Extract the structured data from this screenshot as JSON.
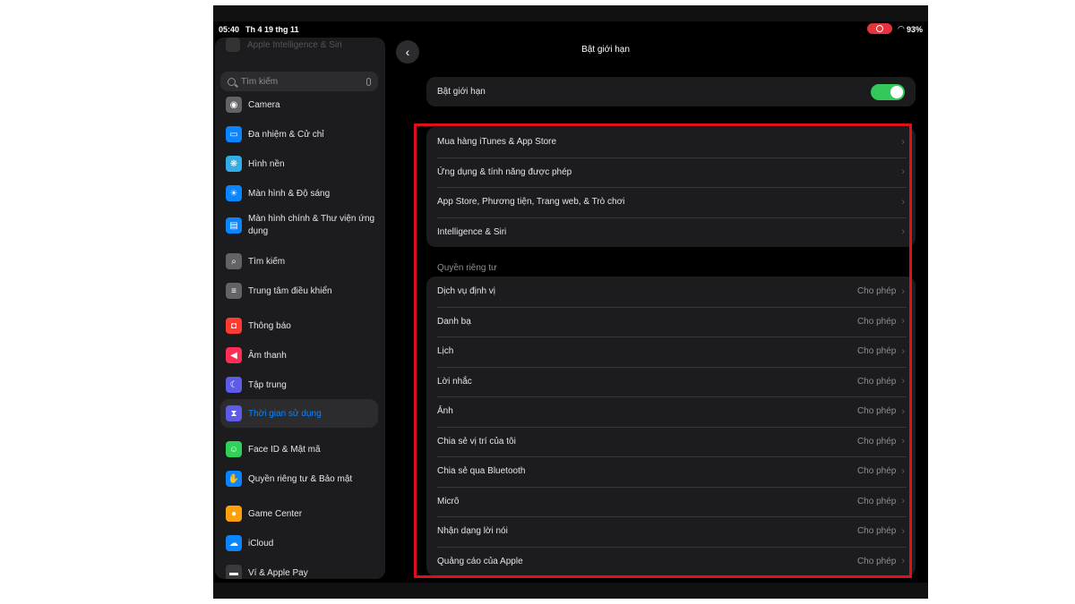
{
  "status": {
    "time": "05:40",
    "date": "Th 4 19 thg 11",
    "battery": "93%"
  },
  "sidebar": {
    "faded_top": "Apple Intelligence & Siri",
    "search_placeholder": "Tìm kiếm",
    "items": [
      {
        "label": "Camera",
        "icon": "camera-icon",
        "color": "#636366"
      },
      {
        "label": "Đa nhiệm & Cử chỉ",
        "icon": "multitasking-icon",
        "color": "#0a84ff"
      },
      {
        "label": "Hình nền",
        "icon": "wallpaper-icon",
        "color": "#32ade6"
      },
      {
        "label": "Màn hình & Độ sáng",
        "icon": "brightness-icon",
        "color": "#0a84ff"
      },
      {
        "label": "Màn hình chính & Thư viện ứng dụng",
        "icon": "home-screen-icon",
        "color": "#0a84ff"
      },
      {
        "label": "Tìm kiếm",
        "icon": "search-icon",
        "color": "#636366"
      },
      {
        "label": "Trung tâm điều khiển",
        "icon": "control-center-icon",
        "color": "#636366"
      },
      {
        "label": "Thông báo",
        "icon": "notifications-icon",
        "color": "#ff3b30"
      },
      {
        "label": "Âm thanh",
        "icon": "sound-icon",
        "color": "#ff2d55"
      },
      {
        "label": "Tập trung",
        "icon": "focus-icon",
        "color": "#5e5ce6"
      },
      {
        "label": "Thời gian sử dụng",
        "icon": "screen-time-icon",
        "color": "#5e5ce6"
      },
      {
        "label": "Face ID & Mật mã",
        "icon": "face-id-icon",
        "color": "#30d158"
      },
      {
        "label": "Quyền riêng tư & Bảo mật",
        "icon": "privacy-icon",
        "color": "#0a84ff"
      },
      {
        "label": "Game Center",
        "icon": "game-center-icon",
        "color": "#ff9f0a"
      },
      {
        "label": "iCloud",
        "icon": "icloud-icon",
        "color": "#0a84ff"
      },
      {
        "label": "Ví & Apple Pay",
        "icon": "wallet-icon",
        "color": "#3a3a3c"
      }
    ]
  },
  "main": {
    "title": "Bật giới hạn",
    "toggle_row": {
      "label": "Bật giới hạn",
      "on": true
    },
    "store_group": [
      "Mua hàng iTunes & App Store",
      "Ứng dụng & tính năng được phép",
      "App Store, Phương tiện, Trang web, & Trò chơi",
      "Intelligence & Siri"
    ],
    "privacy_header": "Quyền riêng tư",
    "privacy_group": [
      {
        "label": "Dịch vụ định vị",
        "value": "Cho phép"
      },
      {
        "label": "Danh bạ",
        "value": "Cho phép"
      },
      {
        "label": "Lịch",
        "value": "Cho phép"
      },
      {
        "label": "Lời nhắc",
        "value": "Cho phép"
      },
      {
        "label": "Ảnh",
        "value": "Cho phép"
      },
      {
        "label": "Chia sẻ vị trí của tôi",
        "value": "Cho phép"
      },
      {
        "label": "Chia sẻ qua Bluetooth",
        "value": "Cho phép"
      },
      {
        "label": "Micrô",
        "value": "Cho phép"
      },
      {
        "label": "Nhận dạng lời nói",
        "value": "Cho phép"
      },
      {
        "label": "Quảng cáo của Apple",
        "value": "Cho phép"
      }
    ]
  }
}
